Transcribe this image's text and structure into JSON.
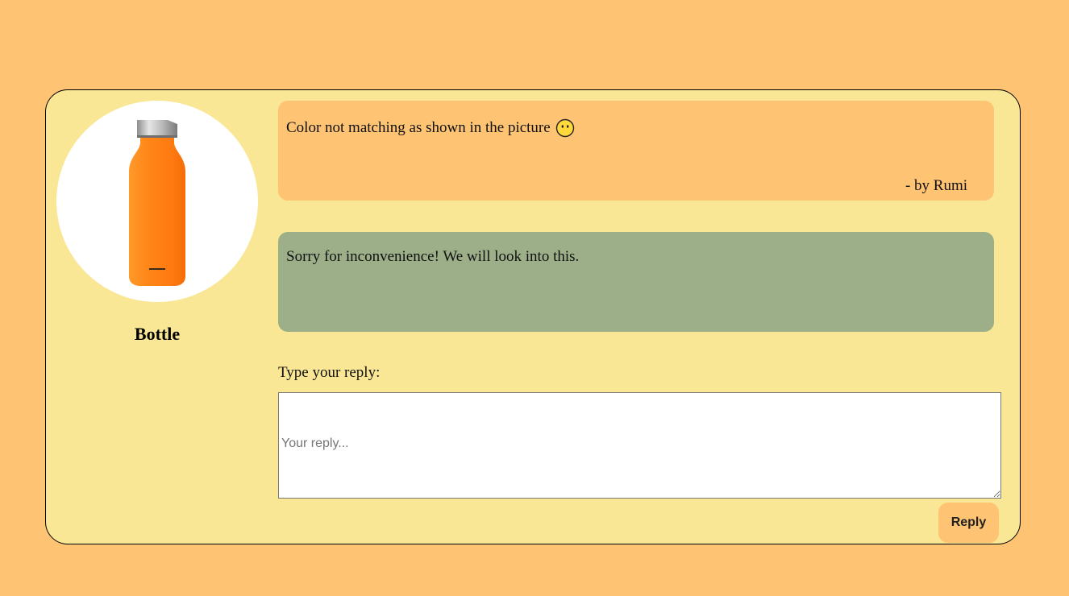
{
  "colors": {
    "page_background": "#ffc374",
    "card_background": "#f9e795",
    "review_background": "#ffc374",
    "response_background": "#9caf88",
    "bottle_orange": "#ff8a1c",
    "button_background": "#ffc374"
  },
  "product": {
    "name": "Bottle",
    "image_icon": "orange-bottle-image"
  },
  "review": {
    "text": "Color not matching as shown in the picture",
    "emoji_icon": "neutral-face-emoji-icon",
    "author": "- by Rumi"
  },
  "response": {
    "text": "Sorry for inconvenience! We will look into this."
  },
  "reply": {
    "label": "Type your reply:",
    "placeholder": "Your reply...",
    "value": "",
    "button_label": "Reply"
  }
}
